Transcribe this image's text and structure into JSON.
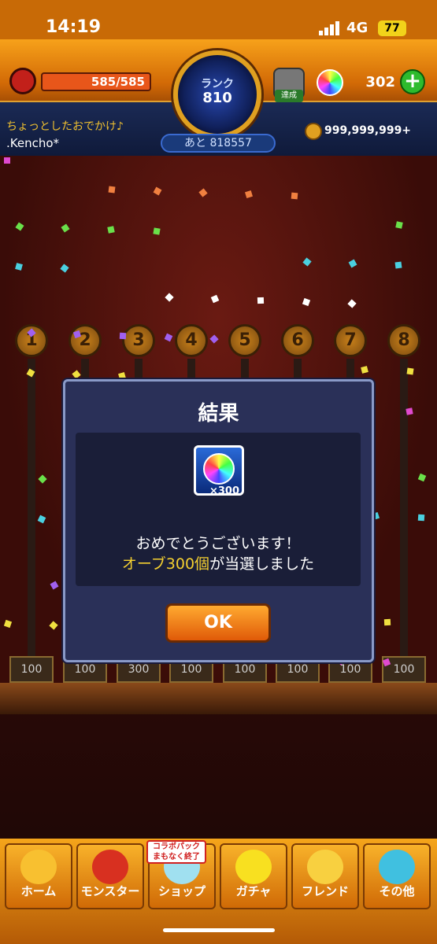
{
  "status_bar": {
    "time": "14:19",
    "network": "4G",
    "battery": "77"
  },
  "header": {
    "stamina": "585/585",
    "rank_label": "ランク",
    "rank_value": "810",
    "rank_next": "あと 818557",
    "achieve_label": "達成",
    "orb_count": "302",
    "subtitle": "ちょっとしたおでかけ♪",
    "player_name": ".Kencho*",
    "gold": "999,999,999+"
  },
  "board": {
    "numbers": [
      "1",
      "2",
      "3",
      "4",
      "5",
      "6",
      "7",
      "8"
    ],
    "pots": [
      "100",
      "100",
      "300",
      "100",
      "100",
      "100",
      "100",
      "100"
    ]
  },
  "dialog": {
    "title": "結果",
    "prize_multiplier": "×300",
    "message_line1": "おめでとうございます！",
    "message_line2_highlight": "オーブ300個",
    "message_line2_rest": "が当選しました",
    "ok_label": "OK"
  },
  "nav": {
    "items": [
      {
        "label": "ホーム"
      },
      {
        "label": "モンスター"
      },
      {
        "label": "ショップ"
      },
      {
        "label": "ガチャ"
      },
      {
        "label": "フレンド"
      },
      {
        "label": "その他"
      }
    ],
    "collab_badge": "コラボパック まもなく終了"
  },
  "colors": {
    "accent": "#f5a51a",
    "highlight": "#f5d030",
    "dialog_bg": "#2a3058"
  }
}
